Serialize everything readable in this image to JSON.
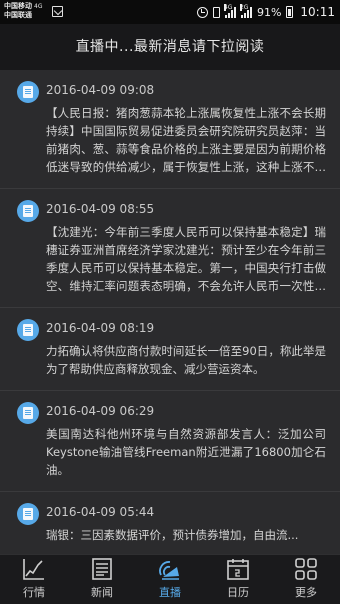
{
  "status_bar": {
    "carrier_1": "中国移动",
    "carrier_1_net": "4G",
    "carrier_2": "中国联通",
    "signal_1_label": "4G",
    "signal_2_label": "2G",
    "battery": "91%",
    "time": "10:11"
  },
  "header": {
    "title": "直播中...最新消息请下拉阅读"
  },
  "feed": {
    "items": [
      {
        "time": "2016-04-09 09:08",
        "text": "【人民日报：猪肉葱蒜本轮上涨属恢复性上涨不会长期持续】中国国际贸易促进委员会研究院研究员赵萍：当前猪肉、葱、蒜等食品价格的上涨主要是因为前期价格低迷导致的供给减少，属于恢复性上涨，这种上涨不会长期维持下去，..."
      },
      {
        "time": "2016-04-09 08:55",
        "text": "【沈建光：今年前三季度人民币可以保持基本稳定】瑞穗证券亚洲首席经济学家沈建光：预计至少在今年前三季度人民币可以保持基本稳定。第一，中国央行打击做空、维持汇率问题表态明确，不会允许人民币一次性贬值。第二，美元..."
      },
      {
        "time": "2016-04-09 08:19",
        "text": "力拓确认将供应商付款时间延长一倍至90日，称此举是为了帮助供应商释放现金、减少营运资本。"
      },
      {
        "time": "2016-04-09 06:29",
        "text": "美国南达科他州环境与自然资源部发言人：泛加公司Keystone输油管线Freeman附近泄漏了16800加仑石油。"
      },
      {
        "time": "2016-04-09 05:44",
        "text": "瑞银：三因素数据评价，预计债券增加，自由流..."
      }
    ]
  },
  "nav": {
    "active_color": "#57a9e8",
    "tabs": [
      {
        "label": "行情",
        "icon": "chart-icon"
      },
      {
        "label": "新闻",
        "icon": "newspaper-icon"
      },
      {
        "label": "直播",
        "icon": "broadcast-icon",
        "active": true
      },
      {
        "label": "日历",
        "icon": "calendar-icon"
      },
      {
        "label": "更多",
        "icon": "grid-icon"
      }
    ]
  }
}
